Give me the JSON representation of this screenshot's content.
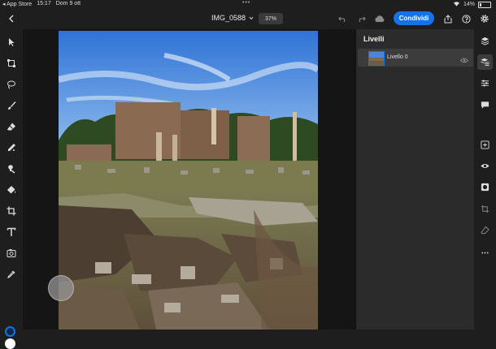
{
  "status_bar": {
    "back_app": "◂ App Store",
    "time": "15:17",
    "date": "Dom 9 ott",
    "dots": "•••",
    "battery": "14%"
  },
  "toolbar": {
    "filename": "IMG_0588",
    "zoom": "37%",
    "share_label": "Condividi"
  },
  "layers_panel": {
    "title": "Livelli",
    "layers": [
      {
        "name": "Livello 0",
        "visible": true,
        "selected": true
      }
    ]
  },
  "left_tools": [
    "select-arrow-icon",
    "transform-icon",
    "lasso-icon",
    "brush-icon",
    "eraser-icon",
    "healing-icon",
    "clone-stamp-icon",
    "paint-bucket-icon",
    "crop-icon",
    "type-icon",
    "place-image-icon",
    "eyedropper-icon"
  ],
  "right_tools": [
    "layers-icon",
    "layer-properties-icon",
    "adjustments-icon",
    "comments-icon",
    "add-layer-icon",
    "visibility-icon",
    "mask-icon",
    "crop-layer-icon",
    "clear-icon",
    "more-icon"
  ],
  "colors": {
    "accent": "#1473e6",
    "foreground_color": "#0b2a4a",
    "background_color": "#ffffff"
  }
}
